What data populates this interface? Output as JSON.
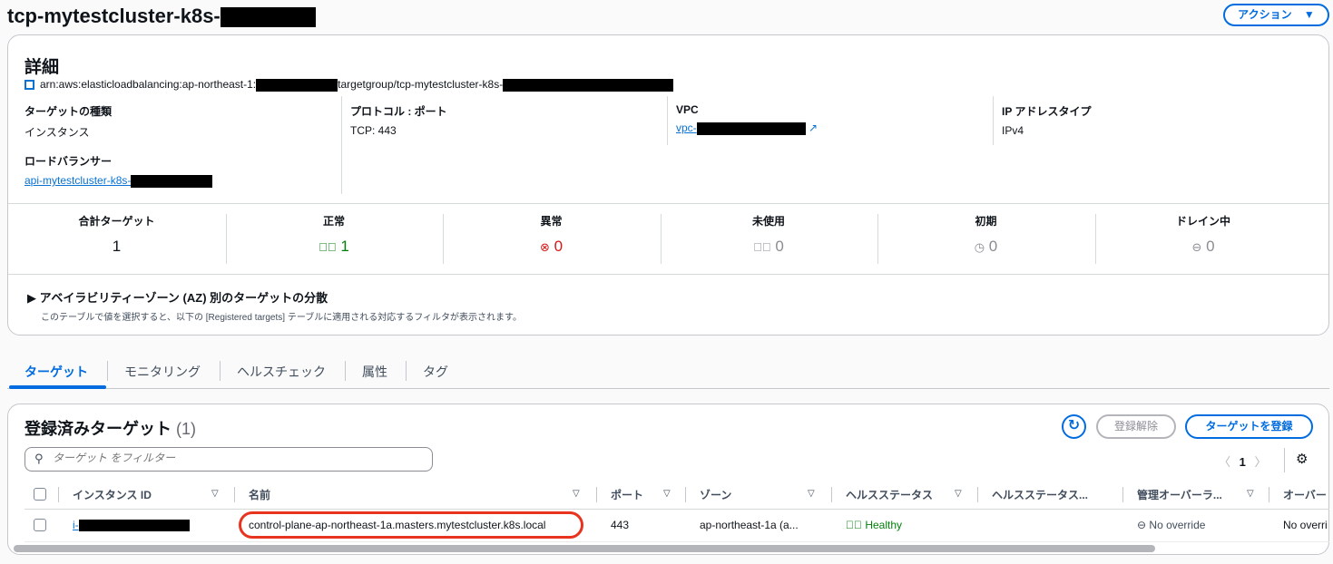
{
  "header": {
    "title": "tcp-mytestcluster-k8s-",
    "actions_label": "アクション"
  },
  "details": {
    "heading": "詳細",
    "arn_prefix": "arn:aws:elasticloadbalancing:ap-northeast-1:",
    "arn_middle": "targetgroup/tcp-mytestcluster-k8s-",
    "target_type_label": "ターゲットの種類",
    "target_type_value": "インスタンス",
    "protocol_label": "プロトコル : ポート",
    "protocol_value": "TCP: 443",
    "vpc_label": "VPC",
    "vpc_value": "vpc-",
    "ip_type_label": "IP アドレスタイプ",
    "ip_type_value": "IPv4",
    "lb_label": "ロードバランサー",
    "lb_value": "api-mytestcluster-k8s-"
  },
  "stats": [
    {
      "label": "合計ターゲット",
      "value": "1",
      "icon": "none",
      "color": "#0f141a"
    },
    {
      "label": "正常",
      "value": "1",
      "icon": "check-circle",
      "color": "#037f0c"
    },
    {
      "label": "異常",
      "value": "0",
      "icon": "x-circle",
      "color": "#d91515"
    },
    {
      "label": "未使用",
      "value": "0",
      "icon": "ellipsis-circle",
      "color": "#8c8c94"
    },
    {
      "label": "初期",
      "value": "0",
      "icon": "clock",
      "color": "#8c8c94"
    },
    {
      "label": "ドレイン中",
      "value": "0",
      "icon": "minus-circle",
      "color": "#8c8c94"
    }
  ],
  "az": {
    "title": "アベイラビリティーゾーン (AZ) 別のターゲットの分散",
    "description": "このテーブルで値を選択すると、以下の [Registered targets] テーブルに適用される対応するフィルタが表示されます。"
  },
  "tabs": [
    "ターゲット",
    "モニタリング",
    "ヘルスチェック",
    "属性",
    "タグ"
  ],
  "targets": {
    "title": "登録済みターゲット",
    "count": "(1)",
    "deregister_label": "登録解除",
    "register_label": "ターゲットを登録",
    "filter_placeholder": "ターゲット をフィルター",
    "page": "1",
    "columns": [
      "インスタンス ID",
      "名前",
      "ポート",
      "ゾーン",
      "ヘルスステータス",
      "ヘルスステータス...",
      "管理オーバーラ...",
      "オーバー"
    ],
    "rows": [
      {
        "instance_id": "i-",
        "name": "control-plane-ap-northeast-1a.masters.mytestcluster.k8s.local",
        "port": "443",
        "zone": "ap-northeast-1a (a...",
        "health": "Healthy",
        "admin_override": "No override",
        "override": "No overri"
      }
    ]
  }
}
